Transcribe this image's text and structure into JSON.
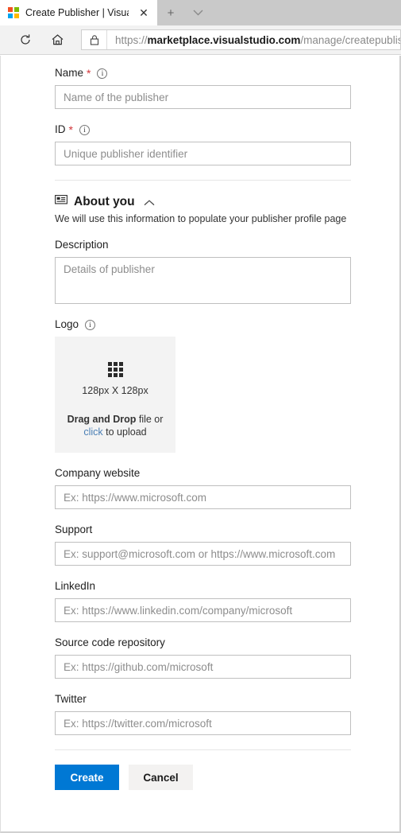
{
  "browser": {
    "tab": {
      "title": "Create Publisher | Visua",
      "favicon": "microsoft-logo",
      "close_label": "✕"
    },
    "new_tab_label": "+",
    "tab_menu_label": "⌄",
    "toolbar": {
      "reload_label": "reload-icon",
      "home_label": "home-icon"
    },
    "address": {
      "lock_label": "lock-icon",
      "url_scheme": "https://",
      "url_host": "marketplace.visualstudio.com",
      "url_path": "/manage/createpublisher"
    }
  },
  "form": {
    "name": {
      "label": "Name",
      "required_marker": "*",
      "info": "i",
      "placeholder": "Name of the publisher",
      "value": ""
    },
    "id": {
      "label": "ID",
      "required_marker": "*",
      "info": "i",
      "placeholder": "Unique publisher identifier",
      "value": ""
    },
    "about_section": {
      "icon": "contact-card-icon",
      "title": "About you",
      "collapse_icon": "∧",
      "subtitle": "We will use this information to populate your publisher profile page"
    },
    "description": {
      "label": "Description",
      "placeholder": "Details of publisher",
      "value": ""
    },
    "logo": {
      "label": "Logo",
      "info": "i",
      "dimensions": "128px X 128px",
      "drag_bold": "Drag and Drop",
      "drag_rest": " file or",
      "click_link": "click",
      "click_rest": " to upload"
    },
    "company_website": {
      "label": "Company website",
      "placeholder": "Ex: https://www.microsoft.com",
      "value": ""
    },
    "support": {
      "label": "Support",
      "placeholder": "Ex: support@microsoft.com or https://www.microsoft.com",
      "value": ""
    },
    "linkedin": {
      "label": "LinkedIn",
      "placeholder": "Ex: https://www.linkedin.com/company/microsoft",
      "value": ""
    },
    "source_code_repository": {
      "label": "Source code repository",
      "placeholder": "Ex: https://github.com/microsoft",
      "value": ""
    },
    "twitter": {
      "label": "Twitter",
      "placeholder": "Ex: https://twitter.com/microsoft",
      "value": ""
    },
    "actions": {
      "create_label": "Create",
      "cancel_label": "Cancel"
    }
  },
  "colors": {
    "primary_button": "#0078d4",
    "required_marker": "#d13438",
    "link": "#4a7fb5",
    "dropzone_background": "#f3f3f3"
  }
}
